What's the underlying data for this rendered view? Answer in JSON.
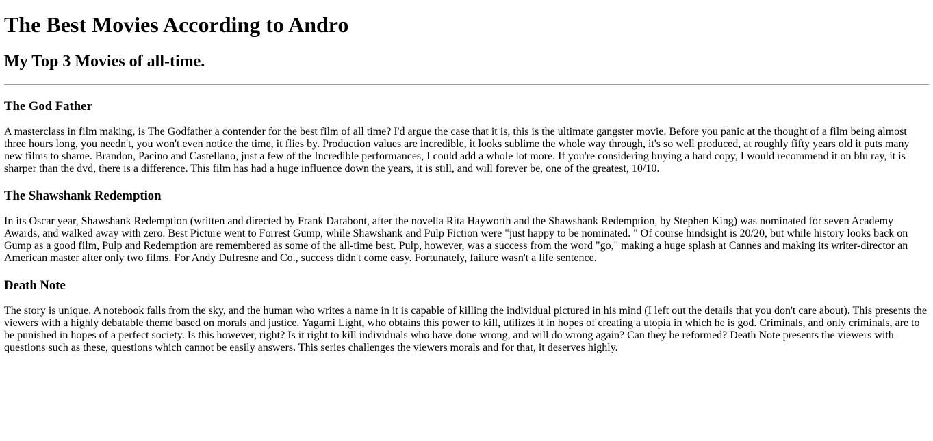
{
  "header": {
    "title": "The Best Movies According to Andro",
    "subtitle": "My Top 3 Movies of all-time."
  },
  "movies": [
    {
      "title": "The God Father",
      "review": "A masterclass in film making, is The Godfather a contender for the best film of all time? I'd argue the case that it is, this is the ultimate gangster movie. Before you panic at the thought of a film being almost three hours long, you needn't, you won't even notice the time, it flies by. Production values are incredible, it looks sublime the whole way through, it's so well produced, at roughly fifty years old it puts many new films to shame. Brandon, Pacino and Castellano, just a few of the Incredible performances, I could add a whole lot more. If you're considering buying a hard copy, I would recommend it on blu ray, it is sharper than the dvd, there is a difference. This film has had a huge influence down the years, it is still, and will forever be, one of the greatest, 10/10."
    },
    {
      "title": "The Shawshank Redemption",
      "review": "In its Oscar year, Shawshank Redemption (written and directed by Frank Darabont, after the novella Rita Hayworth and the Shawshank Redemption, by Stephen King) was nominated for seven Academy Awards, and walked away with zero. Best Picture went to Forrest Gump, while Shawshank and Pulp Fiction were \"just happy to be nominated. \" Of course hindsight is 20/20, but while history looks back on Gump as a good film, Pulp and Redemption are remembered as some of the all-time best. Pulp, however, was a success from the word \"go,\" making a huge splash at Cannes and making its writer-director an American master after only two films. For Andy Dufresne and Co., success didn't come easy. Fortunately, failure wasn't a life sentence."
    },
    {
      "title": "Death Note",
      "review": "The story is unique. A notebook falls from the sky, and the human who writes a name in it is capable of killing the individual pictured in his mind (I left out the details that you don't care about). This presents the viewers with a highly debatable theme based on morals and justice. Yagami Light, who obtains this power to kill, utilizes it in hopes of creating a utopia in which he is god. Criminals, and only criminals, are to be punished in hopes of a perfect society. Is this however, right? Is it right to kill individuals who have done wrong, and will do wrong again? Can they be reformed? Death Note presents the viewers with questions such as these, questions which cannot be easily answers. This series challenges the viewers morals and for that, it deserves highly."
    }
  ]
}
